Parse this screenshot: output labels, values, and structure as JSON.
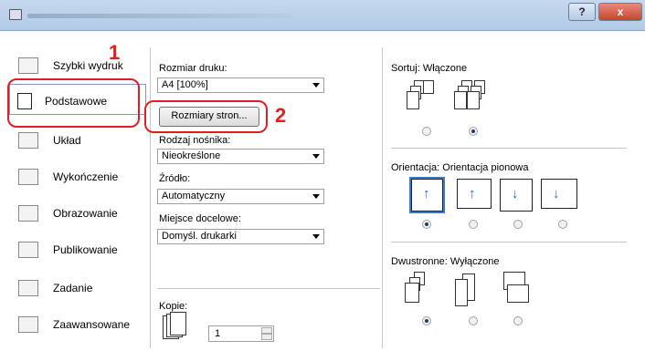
{
  "window": {
    "help_label": "?",
    "close_label": "x"
  },
  "sidebar": {
    "items": [
      {
        "label": "Szybki wydruk"
      },
      {
        "label": "Podstawowe"
      },
      {
        "label": "Układ"
      },
      {
        "label": "Wykończenie"
      },
      {
        "label": "Obrazowanie"
      },
      {
        "label": "Publikowanie"
      },
      {
        "label": "Zadanie"
      },
      {
        "label": "Zaawansowane"
      }
    ]
  },
  "basic": {
    "print_size_label": "Rozmiar druku:",
    "print_size_value": "A4 [100%]",
    "page_sizes_button": "Rozmiary stron...",
    "media_type_label": "Rodzaj nośnika:",
    "media_type_value": "Nieokreślone",
    "source_label": "Źródło:",
    "source_value": "Automatyczny",
    "destination_label": "Miejsce docelowe:",
    "destination_value": "Domyśl. drukarki",
    "copies_label": "Kopie:",
    "copies_value": "1"
  },
  "right": {
    "collate": {
      "label": "Sortuj:",
      "value": "Włączone"
    },
    "orientation": {
      "label": "Orientacja:",
      "value": "Orientacja pionowa",
      "selected_index": 0
    },
    "duplex": {
      "label": "Dwustronne:",
      "value": "Wyłączone",
      "selected_index": 0
    },
    "collate_selected_index": 1
  },
  "callouts": {
    "one": "1",
    "two": "2"
  },
  "colors": {
    "callout": "#e02020",
    "accent": "#2a6ab5"
  }
}
